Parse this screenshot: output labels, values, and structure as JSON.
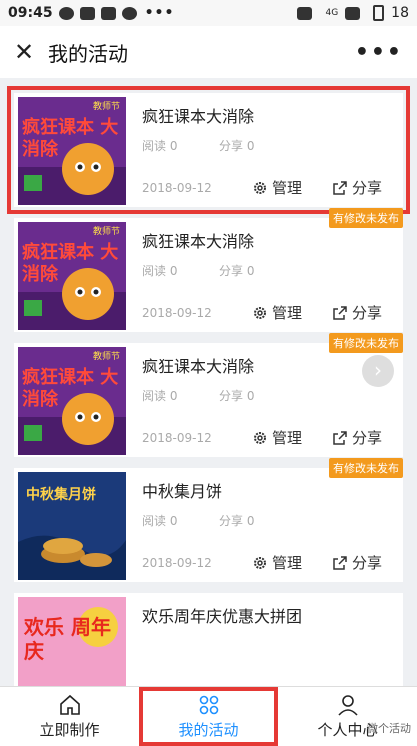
{
  "status_bar": {
    "time": "09:45",
    "network": "4G",
    "battery": "18",
    "more": "•••"
  },
  "header": {
    "title": "我的活动"
  },
  "cards": [
    {
      "title": "疯狂课本大消除",
      "read": "阅读 0",
      "share": "分享 0",
      "date": "2018-09-12",
      "manage": "管理",
      "share_action": "分享",
      "badge": "",
      "thumb_text": "疯狂课本 大消除",
      "thumb_small": "教师节"
    },
    {
      "title": "疯狂课本大消除",
      "read": "阅读 0",
      "share": "分享 0",
      "date": "2018-09-12",
      "manage": "管理",
      "share_action": "分享",
      "badge": "有修改未发布",
      "thumb_text": "疯狂课本 大消除",
      "thumb_small": "教师节"
    },
    {
      "title": "疯狂课本大消除",
      "read": "阅读 0",
      "share": "分享 0",
      "date": "2018-09-12",
      "manage": "管理",
      "share_action": "分享",
      "badge": "有修改未发布",
      "thumb_text": "疯狂课本 大消除",
      "thumb_small": "教师节"
    },
    {
      "title": "中秋集月饼",
      "read": "阅读 0",
      "share": "分享 0",
      "date": "2018-09-12",
      "manage": "管理",
      "share_action": "分享",
      "badge": "有修改未发布",
      "thumb_text": "中秋集月饼",
      "thumb_small": ""
    },
    {
      "title": "欢乐周年庆优惠大拼团",
      "read": "",
      "share": "",
      "date": "",
      "manage": "",
      "share_action": "",
      "badge": "",
      "thumb_text": "欢乐 周年庆",
      "thumb_small": ""
    }
  ],
  "tabs": [
    {
      "label": "立即制作"
    },
    {
      "label": "我的活动"
    },
    {
      "label": "个人中心"
    }
  ],
  "watermark": "微个活动",
  "colors": {
    "accent": "#1e90ff",
    "badge": "#f39a1e",
    "highlight": "#e53935"
  }
}
